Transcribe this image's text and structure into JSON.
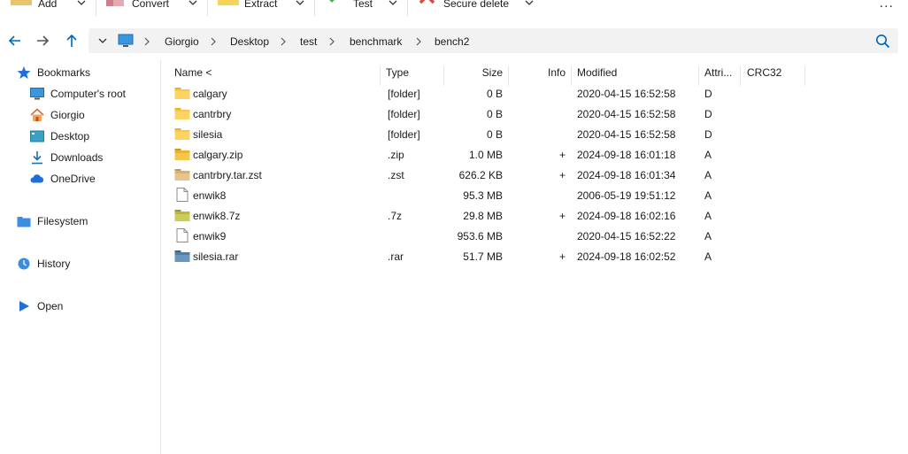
{
  "toolbar": {
    "add_label": "Add",
    "convert_label": "Convert",
    "extract_label": "Extract",
    "test_label": "Test",
    "secure_delete_label": "Secure delete",
    "more_label": "..."
  },
  "address": {
    "crumbs": [
      "Giorgio",
      "Desktop",
      "test",
      "benchmark",
      "bench2"
    ]
  },
  "sidebar": {
    "items": [
      {
        "label": "Bookmarks",
        "icon": "star-icon"
      },
      {
        "label": "Computer's root",
        "icon": "monitor-icon"
      },
      {
        "label": "Giorgio",
        "icon": "home-icon"
      },
      {
        "label": "Desktop",
        "icon": "desktop-icon"
      },
      {
        "label": "Downloads",
        "icon": "download-icon"
      },
      {
        "label": "OneDrive",
        "icon": "cloud-icon"
      },
      {
        "label": "Filesystem",
        "icon": "folder-icon"
      },
      {
        "label": "History",
        "icon": "history-icon"
      },
      {
        "label": "Open",
        "icon": "play-icon"
      }
    ]
  },
  "columns": {
    "name": "Name <",
    "type": "Type",
    "size": "Size",
    "info": "Info",
    "modified": "Modified",
    "attri": "Attri...",
    "crc": "CRC32"
  },
  "files": [
    {
      "name": "calgary",
      "type": "[folder]",
      "size": "0 B",
      "info": "",
      "modified": "2020-04-15 16:52:58",
      "attr": "D",
      "kind": "folder"
    },
    {
      "name": "cantrbry",
      "type": "[folder]",
      "size": "0 B",
      "info": "",
      "modified": "2020-04-15 16:52:58",
      "attr": "D",
      "kind": "folder"
    },
    {
      "name": "silesia",
      "type": "[folder]",
      "size": "0 B",
      "info": "",
      "modified": "2020-04-15 16:52:58",
      "attr": "D",
      "kind": "folder"
    },
    {
      "name": "calgary.zip",
      "type": ".zip",
      "size": "1.0 MB",
      "info": "+",
      "modified": "2024-09-18 16:01:18",
      "attr": "A",
      "kind": "zip"
    },
    {
      "name": "cantrbry.tar.zst",
      "type": ".zst",
      "size": "626.2 KB",
      "info": "+",
      "modified": "2024-09-18 16:01:34",
      "attr": "A",
      "kind": "zst"
    },
    {
      "name": "enwik8",
      "type": "",
      "size": "95.3 MB",
      "info": "",
      "modified": "2006-05-19 19:51:12",
      "attr": "A",
      "kind": "file"
    },
    {
      "name": "enwik8.7z",
      "type": ".7z",
      "size": "29.8 MB",
      "info": "+",
      "modified": "2024-09-18 16:02:16",
      "attr": "A",
      "kind": "7z"
    },
    {
      "name": "enwik9",
      "type": "",
      "size": "953.6 MB",
      "info": "",
      "modified": "2020-04-15 16:52:22",
      "attr": "A",
      "kind": "file"
    },
    {
      "name": "silesia.rar",
      "type": ".rar",
      "size": "51.7 MB",
      "info": "+",
      "modified": "2024-09-18 16:02:52",
      "attr": "A",
      "kind": "rar"
    }
  ],
  "colors": {
    "accent": "#0067c0",
    "folder": "#f8c843",
    "zip": "#e8b430",
    "zst": "#d9b070",
    "sevenz": "#b8b840",
    "rar": "#4a7fb0"
  }
}
